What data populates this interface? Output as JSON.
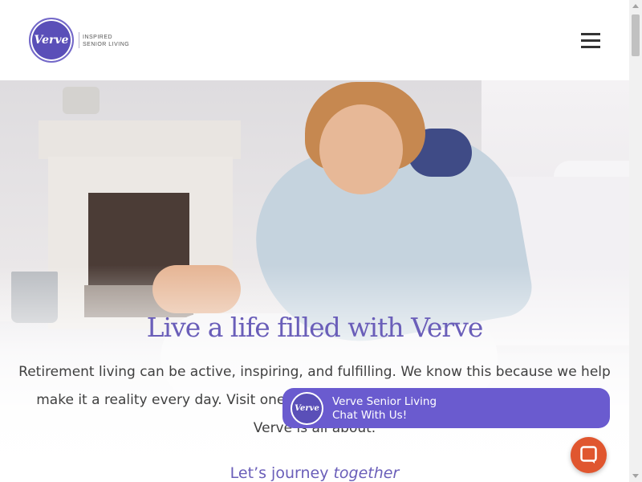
{
  "header": {
    "logo_text": "Verve",
    "tagline_line1": "INSPIRED",
    "tagline_line2": "SENIOR LIVING",
    "menu_icon": "hamburger-menu-icon"
  },
  "hero": {
    "title": "Live a life filled with Verve",
    "body_line1": "Retirement living can be active, inspiring, and fulfilling. We know this because we help",
    "body_line2": "make it a reality every day. Visit one of o",
    "body_line2_tail": "h",
    "body_line3": "Verve is all about.",
    "journey_prefix": "Let’s journey ",
    "journey_emphasis": "together"
  },
  "chat": {
    "logo_text": "Verve",
    "title": "Verve Senior Living",
    "subtitle": "Chat With Us!",
    "launcher_icon": "chat-bubble-icon"
  },
  "colors": {
    "brand_purple": "#6a5eb9",
    "chat_purple": "#6a5bcf",
    "launcher_orange": "#e0562f"
  }
}
